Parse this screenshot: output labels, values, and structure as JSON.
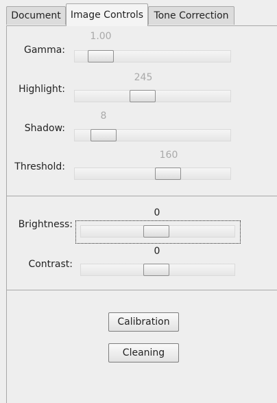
{
  "tabs": [
    "Document",
    "Image Controls",
    "Tone Correction"
  ],
  "active_tab": "Image Controls",
  "image_sliders": [
    {
      "label": "Gamma:",
      "value": "1.00",
      "position": 0.1
    },
    {
      "label": "Highlight:",
      "value": "245",
      "position": 0.44
    },
    {
      "label": "Shadow:",
      "value": "8",
      "position": 0.12
    },
    {
      "label": "Threshold:",
      "value": "160",
      "position": 0.61
    }
  ],
  "adjust_sliders": [
    {
      "label": "Brightness:",
      "value": "0",
      "position": 0.5
    },
    {
      "label": "Contrast:",
      "value": "0",
      "position": 0.5
    }
  ],
  "buttons": {
    "calibration": "Calibration",
    "cleaning": "Cleaning"
  }
}
